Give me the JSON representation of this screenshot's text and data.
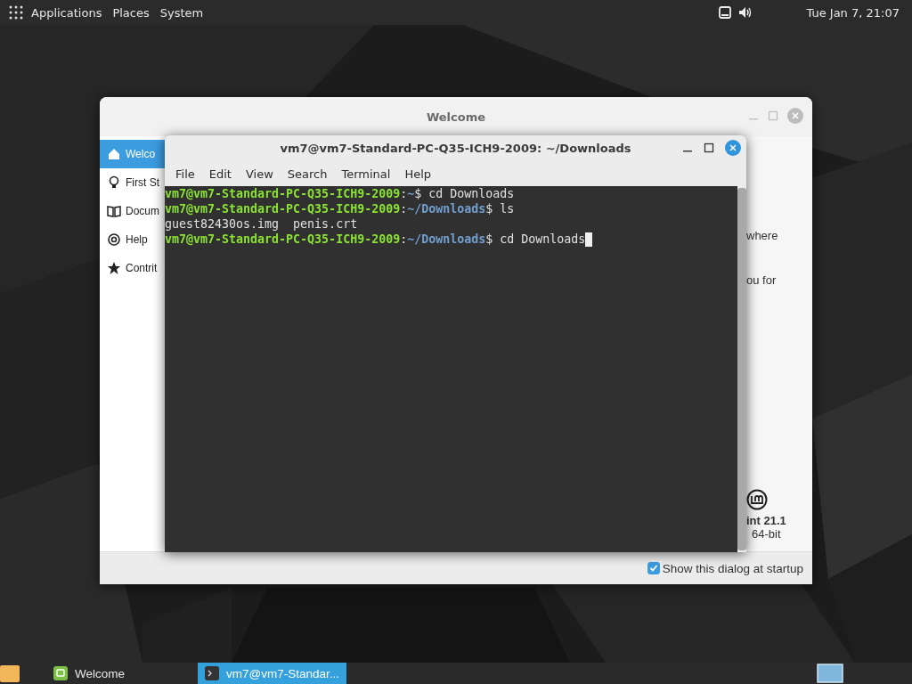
{
  "top_panel": {
    "menus": [
      "Applications",
      "Places",
      "System"
    ],
    "clock": "Tue Jan 7, 21:07"
  },
  "welcome_window": {
    "title": "Welcome",
    "sidebar": [
      {
        "label": "Welco",
        "selected": true
      },
      {
        "label": "First St",
        "selected": false
      },
      {
        "label": "Docum",
        "selected": false
      },
      {
        "label": "Help",
        "selected": false
      },
      {
        "label": "Contrit",
        "selected": false
      }
    ],
    "content_fragments": [
      "where",
      "ou for"
    ],
    "version": "int 21.1",
    "arch": "64-bit",
    "startup_checkbox": {
      "label": "Show this dialog at startup",
      "checked": true
    }
  },
  "terminal_window": {
    "title": "vm7@vm7-Standard-PC-Q35-ICH9-2009: ~/Downloads",
    "menu": [
      "File",
      "Edit",
      "View",
      "Search",
      "Terminal",
      "Help"
    ],
    "lines": [
      [
        {
          "kind": "host",
          "text": "vm7@vm7-Standard-PC-Q35-ICH9-2009"
        },
        {
          "kind": "plain",
          "text": ":"
        },
        {
          "kind": "path",
          "text": "~"
        },
        {
          "kind": "plain",
          "text": "$ cd Downloads"
        }
      ],
      [
        {
          "kind": "host",
          "text": "vm7@vm7-Standard-PC-Q35-ICH9-2009"
        },
        {
          "kind": "plain",
          "text": ":"
        },
        {
          "kind": "path",
          "text": "~/Downloads"
        },
        {
          "kind": "plain",
          "text": "$ ls"
        }
      ],
      [
        {
          "kind": "plain",
          "text": "guest82430os.img  penis.crt"
        }
      ],
      [
        {
          "kind": "host",
          "text": "vm7@vm7-Standard-PC-Q35-ICH9-2009"
        },
        {
          "kind": "plain",
          "text": ":"
        },
        {
          "kind": "path",
          "text": "~/Downloads"
        },
        {
          "kind": "plain",
          "text": "$ cd Downloads"
        }
      ]
    ],
    "cursor": true
  },
  "taskbar": {
    "items": [
      {
        "label": "Welcome",
        "selected": false
      },
      {
        "label": "vm7@vm7-Standar...",
        "selected": true
      }
    ]
  }
}
